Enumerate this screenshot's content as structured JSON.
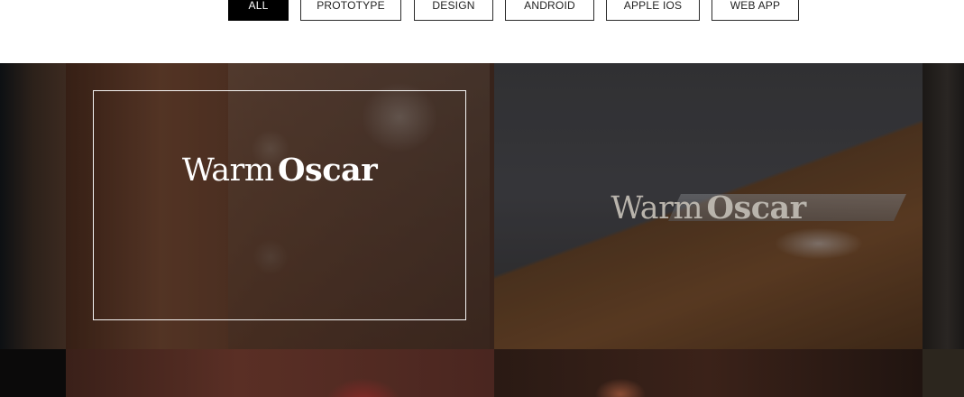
{
  "filters": {
    "items": [
      {
        "label": "ALL",
        "active": true
      },
      {
        "label": "PROTOTYPE",
        "active": false
      },
      {
        "label": "DESIGN",
        "active": false
      },
      {
        "label": "ANDROID",
        "active": false
      },
      {
        "label": "APPLE IOS",
        "active": false
      },
      {
        "label": "WEB APP",
        "active": false
      }
    ]
  },
  "gallery": {
    "tiles": [
      {
        "title_part1": "Warm",
        "title_part2": "Oscar",
        "hovered": true
      },
      {
        "title_part1": "Warm",
        "title_part2": "Oscar",
        "hovered": false
      }
    ]
  },
  "colors": {
    "active_filter_bg": "#000000",
    "filter_border": "#2b2b2b",
    "hover_title": "#ffffff",
    "idle_title": "#b9b4ac"
  }
}
